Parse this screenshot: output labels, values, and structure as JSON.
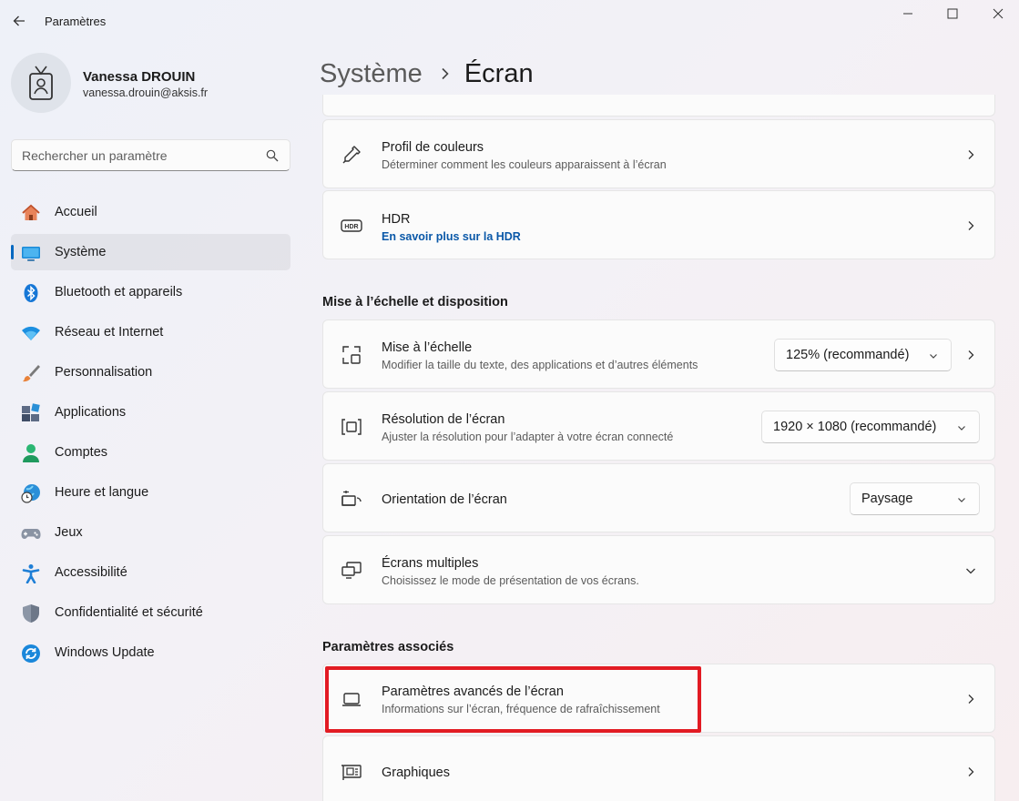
{
  "window": {
    "title": "Paramètres"
  },
  "profile": {
    "name": "Vanessa DROUIN",
    "email": "vanessa.drouin@aksis.fr"
  },
  "search": {
    "placeholder": "Rechercher un paramètre"
  },
  "sidebar": {
    "items": [
      {
        "label": "Accueil",
        "icon": "home-icon"
      },
      {
        "label": "Système",
        "icon": "monitor-icon",
        "active": true
      },
      {
        "label": "Bluetooth et appareils",
        "icon": "bluetooth-icon"
      },
      {
        "label": "Réseau et Internet",
        "icon": "wifi-icon"
      },
      {
        "label": "Personnalisation",
        "icon": "brush-icon"
      },
      {
        "label": "Applications",
        "icon": "apps-icon"
      },
      {
        "label": "Comptes",
        "icon": "person-icon"
      },
      {
        "label": "Heure et langue",
        "icon": "globe-clock-icon"
      },
      {
        "label": "Jeux",
        "icon": "gamepad-icon"
      },
      {
        "label": "Accessibilité",
        "icon": "accessibility-icon"
      },
      {
        "label": "Confidentialité et sécurité",
        "icon": "shield-icon"
      },
      {
        "label": "Windows Update",
        "icon": "update-icon"
      }
    ]
  },
  "breadcrumb": {
    "parent": "Système",
    "current": "Écran"
  },
  "cards": {
    "color_profile": {
      "title": "Profil de couleurs",
      "subtitle": "Déterminer comment les couleurs apparaissent à l’écran"
    },
    "hdr": {
      "title": "HDR",
      "link": "En savoir plus sur la HDR"
    },
    "scale": {
      "title": "Mise à l’échelle",
      "subtitle": "Modifier la taille du texte, des applications et d’autres éléments",
      "value": "125% (recommandé)"
    },
    "resolution": {
      "title": "Résolution de l’écran",
      "subtitle": "Ajuster la résolution pour l’adapter à  votre  écran connecté",
      "value": "1920 × 1080 (recommandé)"
    },
    "orientation": {
      "title": "Orientation de l’écran",
      "value": "Paysage"
    },
    "multiple": {
      "title": "Écrans multiples",
      "subtitle": "Choisissez le mode de présentation de vos écrans."
    },
    "advanced": {
      "title": "Paramètres avancés de l’écran",
      "subtitle": "Informations sur l’écran, fréquence de rafraîchissement"
    },
    "graphics": {
      "title": "Graphiques"
    }
  },
  "sections": {
    "scale_layout": "Mise à l’échelle et disposition",
    "related": "Paramètres associés"
  },
  "colors": {
    "accent": "#0067c0",
    "highlight": "#e21b23"
  }
}
